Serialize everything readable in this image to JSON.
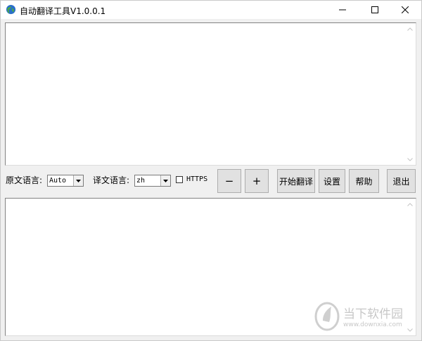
{
  "window": {
    "title": "自动翻译工具V1.0.0.1",
    "icons": {
      "app": "globe-icon",
      "minimize": "minimize-icon",
      "maximize": "maximize-icon",
      "close": "close-icon"
    }
  },
  "controls": {
    "source_label": "原文语言:",
    "source_value": "Auto",
    "target_label": "译文语言:",
    "target_value": "zh",
    "https_label": "HTTPS",
    "https_checked": false,
    "minus_label": "−",
    "plus_label": "+",
    "start_label": "开始翻译",
    "settings_label": "设置",
    "help_label": "帮助",
    "exit_label": "退出"
  },
  "source_text": "",
  "result_text": "",
  "watermark": {
    "name": "当下软件园",
    "url": "www.downxia.com"
  }
}
